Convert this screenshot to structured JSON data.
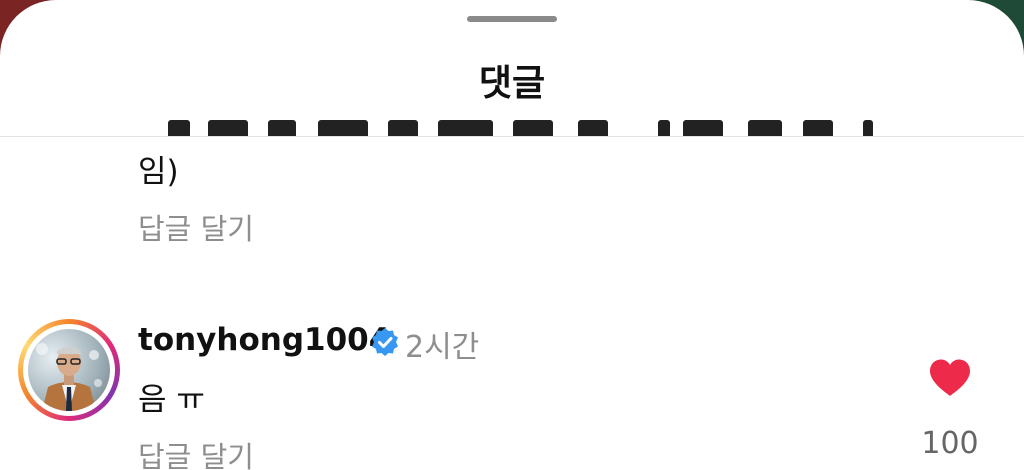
{
  "sheet": {
    "title": "댓글"
  },
  "previous_comment": {
    "text_tail": "임)",
    "reply_label": "답글 달기"
  },
  "comment": {
    "username": "tonyhong1004",
    "verified": true,
    "time": "2시간",
    "text": "음 ㅠ",
    "reply_label": "답글 달기",
    "likes": "100",
    "liked": true
  },
  "colors": {
    "heart": "#ed2a4a",
    "verified_badge": "#3897f0",
    "secondary_text": "#8e8e8e"
  }
}
